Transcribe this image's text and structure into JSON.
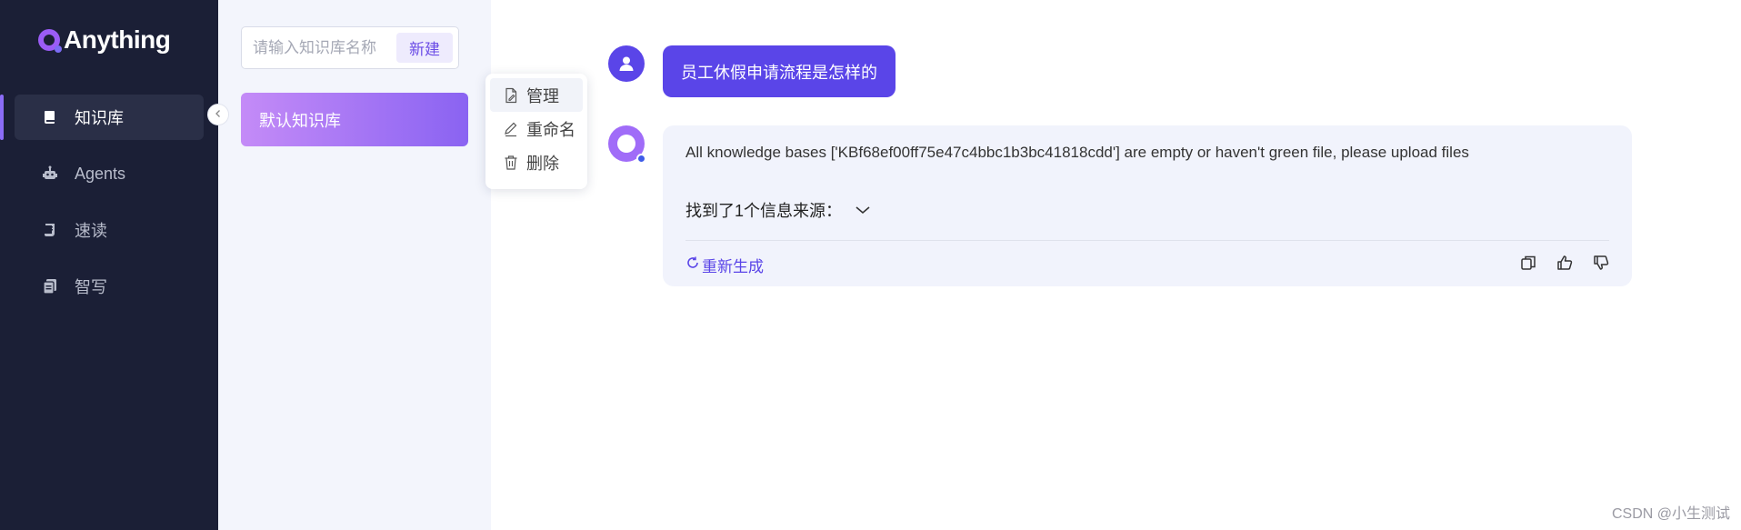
{
  "app": {
    "title": "Anything"
  },
  "sidebar": {
    "items": [
      {
        "label": "知识库",
        "icon": "book-icon",
        "active": true
      },
      {
        "label": "Agents",
        "icon": "robot-icon",
        "active": false
      },
      {
        "label": "速读",
        "icon": "scroll-icon",
        "active": false
      },
      {
        "label": "智写",
        "icon": "documents-icon",
        "active": false
      }
    ]
  },
  "kb": {
    "search_placeholder": "请输入知识库名称",
    "new_label": "新建",
    "items": [
      {
        "label": "默认知识库"
      }
    ]
  },
  "context_menu": {
    "items": [
      {
        "label": "管理",
        "icon": "manage-icon"
      },
      {
        "label": "重命名",
        "icon": "edit-icon"
      },
      {
        "label": "删除",
        "icon": "trash-icon"
      }
    ]
  },
  "chat": {
    "user_message": "员工休假申请流程是怎样的",
    "bot_message": "All knowledge bases ['KBf68ef00ff75e47c4bbc1b3bc41818cdd'] are empty or haven't green file, please upload files",
    "source_label": "找到了1个信息来源：",
    "regenerate_label": "重新生成"
  },
  "watermark": "CSDN @小生测试",
  "colors": {
    "sidebar_bg": "#1b1f36",
    "accent": "#5a45e8",
    "panel_bg": "#f3f5fc"
  }
}
